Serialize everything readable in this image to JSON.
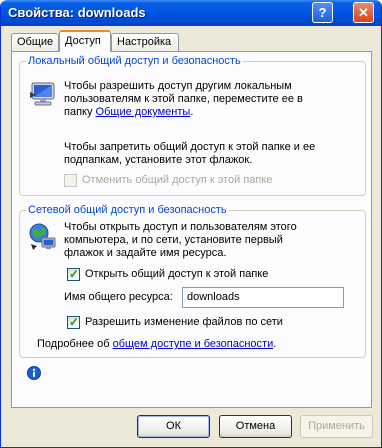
{
  "window": {
    "title": "Свойства: downloads",
    "help_glyph": "?",
    "close_glyph": "✕"
  },
  "tabs": [
    {
      "label": "Общие"
    },
    {
      "label": "Доступ"
    },
    {
      "label": "Настройка"
    }
  ],
  "local_sharing": {
    "group_title": "Локальный общий доступ и безопасность",
    "text1_line1": "Чтобы разрешить доступ другим локальным",
    "text1_line2": "пользователям к этой папке, переместите ее в",
    "text1_line3_prefix": "папку ",
    "text1_link": "Общие документы",
    "text1_line3_suffix": ".",
    "text2_line1": "Чтобы запретить общий доступ к этой папке и ее",
    "text2_line2": "подпапкам, установите этот флажок.",
    "checkbox_label": "Отменить общий доступ к этой папке",
    "checkbox_checked": false,
    "checkbox_enabled": false
  },
  "network_sharing": {
    "group_title": "Сетевой общий доступ и безопасность",
    "text_line1": "Чтобы открыть доступ и пользователям этого",
    "text_line2": "компьютера, и по сети, установите первый",
    "text_line3": "флажок и задайте имя ресурса.",
    "share_checkbox_label": "Открыть общий доступ к этой папке",
    "share_checked": true,
    "share_name_label": "Имя общего ресурса:",
    "share_name_value": "downloads",
    "allow_change_label": "Разрешить изменение файлов по сети",
    "allow_change_checked": true,
    "more_info_prefix": "Подробнее об ",
    "more_info_link": "общем доступе и безопасности",
    "more_info_suffix": "."
  },
  "buttons": {
    "ok": "ОК",
    "cancel": "Отмена",
    "apply": "Применить"
  },
  "colors": {
    "title_bar": "#0054e3",
    "group_title": "#0046d5",
    "link": "#0000cc",
    "dialog_bg": "#ece9d8"
  }
}
